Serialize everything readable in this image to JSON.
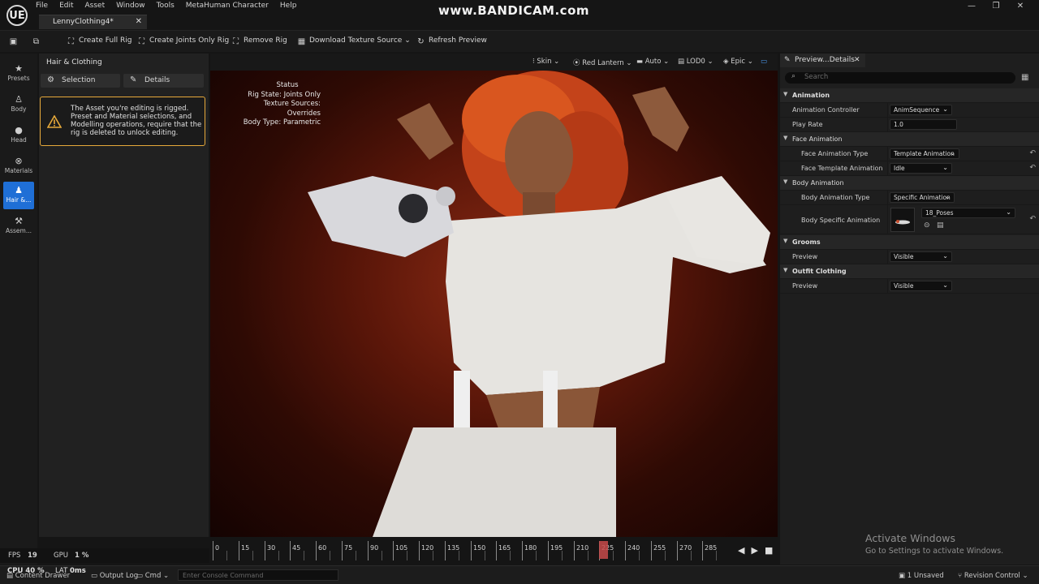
{
  "app": {
    "logo": "UE",
    "menu": [
      "File",
      "Edit",
      "Asset",
      "Window",
      "Tools",
      "MetaHuman Character",
      "Help"
    ],
    "watermark": "www.BANDICAM.com",
    "tab_title": "LennyClothing4*"
  },
  "toolbar": {
    "create_full_rig": "Create Full Rig",
    "create_joints_only_rig": "Create Joints Only Rig",
    "remove_rig": "Remove Rig",
    "download_texture_source": "Download Texture Source",
    "refresh_preview": "Refresh Preview"
  },
  "rail": {
    "items": [
      "Presets",
      "Body",
      "Head",
      "Materials",
      "Hair &...",
      "Assem..."
    ],
    "active_index": 4
  },
  "left_panel": {
    "title": "Hair & Clothing",
    "tab_selection": "Selection",
    "tab_details": "Details",
    "warning": "The Asset you're editing is rigged. Preset and Material selections, and Modelling operations, require that the rig is deleted to unlock editing."
  },
  "viewport_toolbar": {
    "skin": "Skin",
    "lighting": "Red Lantern",
    "auto": "Auto",
    "lod": "LOD0",
    "quality": "Epic"
  },
  "status": {
    "heading": "Status",
    "rig_state": "Rig State: Joints Only",
    "texture_sources": "Texture Sources: Overrides",
    "body_type": "Body Type: Parametric"
  },
  "timeline": {
    "ticks": [
      "0",
      "15",
      "30",
      "45",
      "60",
      "75",
      "90",
      "105",
      "120",
      "135",
      "150",
      "165",
      "180",
      "195",
      "210",
      "225",
      "240",
      "255",
      "270",
      "285"
    ],
    "current_frame": "225"
  },
  "perf": {
    "fps_label": "FPS",
    "fps_value": "19",
    "gpu_label": "GPU",
    "gpu_value": "1 %",
    "cpu_label": "CPU",
    "cpu_value": "40 %",
    "lat_label": "LAT",
    "lat_value": "0ms"
  },
  "bottom_bar": {
    "content_drawer": "Content Drawer",
    "output_log": "Output Log",
    "cmd": "Cmd",
    "console_placeholder": "Enter Console Command",
    "unsaved": "1 Unsaved",
    "revision_control": "Revision Control"
  },
  "details": {
    "tab_title": "Preview...Details",
    "search_placeholder": "Search",
    "sections": {
      "animation": "Animation",
      "face_animation": "Face Animation",
      "body_animation": "Body Animation",
      "grooms": "Grooms",
      "outfit_clothing": "Outfit Clothing"
    },
    "props": {
      "animation_controller_label": "Animation Controller",
      "animation_controller_value": "AnimSequence",
      "play_rate_label": "Play Rate",
      "play_rate_value": "1.0",
      "face_animation_type_label": "Face Animation Type",
      "face_animation_type_value": "Template Animation",
      "face_template_animation_label": "Face Template Animation",
      "face_template_animation_value": "Idle",
      "body_animation_type_label": "Body Animation Type",
      "body_animation_type_value": "Specific Animation",
      "body_specific_animation_label": "Body Specific Animation",
      "body_specific_animation_value": "18_Poses",
      "grooms_preview_label": "Preview",
      "grooms_preview_value": "Visible",
      "outfit_preview_label": "Preview",
      "outfit_preview_value": "Visible"
    }
  },
  "windows_activation": {
    "line1": "Activate Windows",
    "line2": "Go to Settings to activate Windows."
  }
}
